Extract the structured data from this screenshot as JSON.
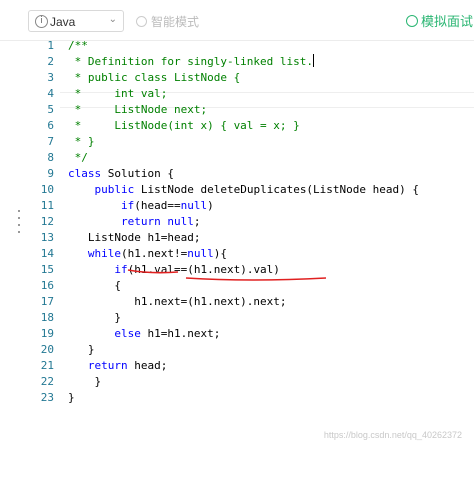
{
  "toolbar": {
    "language": "Java",
    "smart_mode": "智能模式",
    "mock_interview": "模拟面试"
  },
  "editor": {
    "lines": [
      {
        "num": "1",
        "text": "/**"
      },
      {
        "num": "2",
        "text": " * Definition for singly-linked list."
      },
      {
        "num": "3",
        "text": " * public class ListNode {"
      },
      {
        "num": "4",
        "text": " *     int val;"
      },
      {
        "num": "5",
        "text": " *     ListNode next;"
      },
      {
        "num": "6",
        "text": " *     ListNode(int x) { val = x; }"
      },
      {
        "num": "7",
        "text": " * }"
      },
      {
        "num": "8",
        "text": " */"
      },
      {
        "num": "9",
        "text": "class Solution {"
      },
      {
        "num": "10",
        "text": "    public ListNode deleteDuplicates(ListNode head) {"
      },
      {
        "num": "11",
        "text": "        if(head==null)"
      },
      {
        "num": "12",
        "text": "        return null;"
      },
      {
        "num": "13",
        "text": "   ListNode h1=head;"
      },
      {
        "num": "14",
        "text": "   while(h1.next!=null){"
      },
      {
        "num": "15",
        "text": "       if(h1.val==(h1.next).val)"
      },
      {
        "num": "16",
        "text": "       {"
      },
      {
        "num": "17",
        "text": "          h1.next=(h1.next).next;"
      },
      {
        "num": "18",
        "text": "       }"
      },
      {
        "num": "19",
        "text": "       else h1=h1.next;"
      },
      {
        "num": "20",
        "text": "   }"
      },
      {
        "num": "21",
        "text": "   return head;"
      },
      {
        "num": "22",
        "text": "    }"
      },
      {
        "num": "23",
        "text": "}"
      }
    ]
  },
  "colors": {
    "accent_green": "#2bb673",
    "comment": "#008000",
    "keyword": "#0000ff",
    "line_number": "#237893",
    "annotation_red": "#e02020"
  },
  "watermark": "https://blog.csdn.net/qq_40262372"
}
